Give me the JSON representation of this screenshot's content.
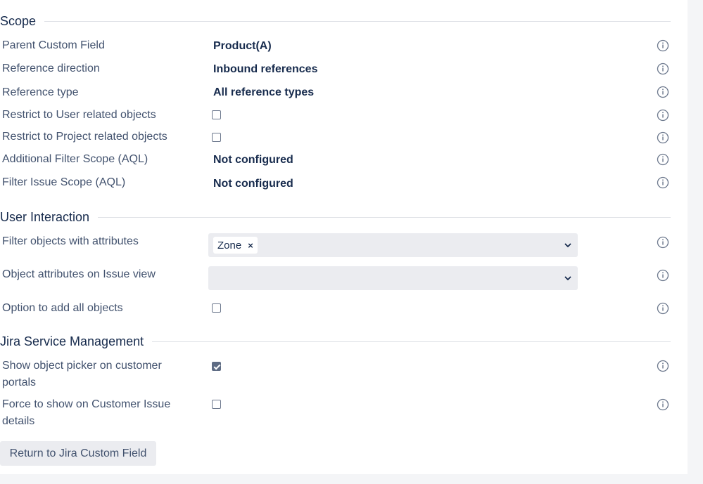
{
  "sections": {
    "scope": "Scope",
    "user_interaction": "User Interaction",
    "jsm": "Jira Service Management"
  },
  "scope_rows": {
    "parent_custom_field": {
      "label": "Parent Custom Field",
      "value": "Product(A)"
    },
    "reference_direction": {
      "label": "Reference direction",
      "value": "Inbound references"
    },
    "reference_type": {
      "label": "Reference type",
      "value": "All reference types"
    },
    "restrict_user": {
      "label": "Restrict to User related objects",
      "checked": false
    },
    "restrict_project": {
      "label": "Restrict to Project related objects",
      "checked": false
    },
    "additional_filter": {
      "label": "Additional Filter Scope (AQL)",
      "value": "Not configured"
    },
    "filter_issue_scope": {
      "label": "Filter Issue Scope (AQL)",
      "value": "Not configured"
    }
  },
  "user_interaction_rows": {
    "filter_attributes": {
      "label": "Filter objects with attributes",
      "selected_tags": [
        "Zone"
      ],
      "remove_glyph": "×"
    },
    "issue_view_attributes": {
      "label": "Object attributes on Issue view",
      "selected_tags": []
    },
    "add_all_objects": {
      "label": "Option to add all objects",
      "checked": false
    }
  },
  "jsm_rows": {
    "customer_portals": {
      "label_line1": "Show object picker on customer",
      "label_line2": "portals",
      "checked": true
    },
    "customer_issue_details": {
      "label_line1": "Force to show on Customer Issue",
      "label_line2": "details",
      "checked": false
    }
  },
  "return_button": "Return to Jira Custom Field",
  "icons": {
    "info": "info-circle-icon",
    "dropdown": "chevron-down-icon"
  },
  "colors": {
    "text": "#172b4d",
    "label": "#42526e",
    "field_bg": "#ebecf0",
    "page_bg": "#f4f5f7"
  }
}
